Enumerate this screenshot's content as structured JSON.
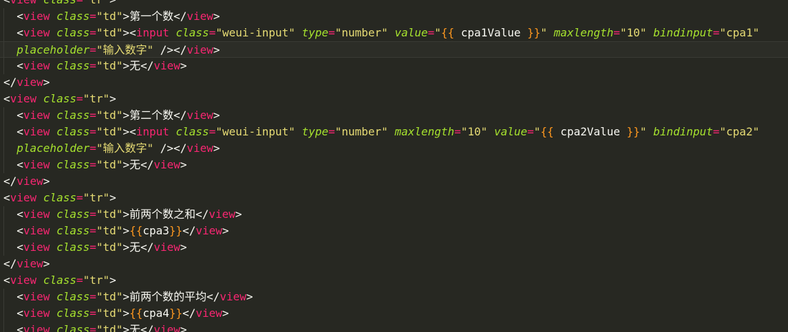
{
  "editor": {
    "language": "wxml",
    "current_line_index": 3,
    "colors": {
      "background": "#272822",
      "tag": "#f92672",
      "attribute": "#a6e22e",
      "string": "#e6db74",
      "brace": "#fd971f",
      "text": "#f8f8f2"
    },
    "lines": [
      [
        {
          "t": "lt",
          "v": "<"
        },
        {
          "t": "tag",
          "v": "view"
        },
        {
          "t": "txt",
          "v": " "
        },
        {
          "t": "attr",
          "v": "class"
        },
        {
          "t": "eq",
          "v": "="
        },
        {
          "t": "str",
          "v": "\"tr\""
        },
        {
          "t": "gt",
          "v": ">"
        }
      ],
      [
        {
          "t": "txt",
          "v": "  "
        },
        {
          "t": "lt",
          "v": "<"
        },
        {
          "t": "tag",
          "v": "view"
        },
        {
          "t": "txt",
          "v": " "
        },
        {
          "t": "attr",
          "v": "class"
        },
        {
          "t": "eq",
          "v": "="
        },
        {
          "t": "str",
          "v": "\"td\""
        },
        {
          "t": "gt",
          "v": ">"
        },
        {
          "t": "txt",
          "v": "第一个数"
        },
        {
          "t": "lt",
          "v": "</"
        },
        {
          "t": "tag",
          "v": "view"
        },
        {
          "t": "gt",
          "v": ">"
        }
      ],
      [
        {
          "t": "txt",
          "v": "  "
        },
        {
          "t": "lt",
          "v": "<"
        },
        {
          "t": "tag",
          "v": "view"
        },
        {
          "t": "txt",
          "v": " "
        },
        {
          "t": "attr",
          "v": "class"
        },
        {
          "t": "eq",
          "v": "="
        },
        {
          "t": "str",
          "v": "\"td\""
        },
        {
          "t": "gt",
          "v": ">"
        },
        {
          "t": "lt",
          "v": "<"
        },
        {
          "t": "tag",
          "v": "input"
        },
        {
          "t": "txt",
          "v": " "
        },
        {
          "t": "attr",
          "v": "class"
        },
        {
          "t": "eq",
          "v": "="
        },
        {
          "t": "str",
          "v": "\"weui-input\""
        },
        {
          "t": "txt",
          "v": " "
        },
        {
          "t": "attr",
          "v": "type"
        },
        {
          "t": "eq",
          "v": "="
        },
        {
          "t": "str",
          "v": "\"number\""
        },
        {
          "t": "txt",
          "v": " "
        },
        {
          "t": "attr",
          "v": "value"
        },
        {
          "t": "eq",
          "v": "="
        },
        {
          "t": "str",
          "v": "\""
        },
        {
          "t": "brace",
          "v": "{{"
        },
        {
          "t": "txt",
          "v": " cpa1Value "
        },
        {
          "t": "brace",
          "v": "}}"
        },
        {
          "t": "str",
          "v": "\""
        },
        {
          "t": "txt",
          "v": " "
        },
        {
          "t": "attr",
          "v": "maxlength"
        },
        {
          "t": "eq",
          "v": "="
        },
        {
          "t": "str",
          "v": "\"10\""
        },
        {
          "t": "txt",
          "v": " "
        },
        {
          "t": "attr",
          "v": "bindinput"
        },
        {
          "t": "eq",
          "v": "="
        },
        {
          "t": "str",
          "v": "\"cpa1\""
        }
      ],
      [
        {
          "t": "txt",
          "v": "  "
        },
        {
          "t": "attr",
          "v": "placeholder"
        },
        {
          "t": "eq",
          "v": "="
        },
        {
          "t": "str",
          "v": "\"输入数字\""
        },
        {
          "t": "txt",
          "v": " /"
        },
        {
          "t": "gt",
          "v": ">"
        },
        {
          "t": "lt",
          "v": "</"
        },
        {
          "t": "tag",
          "v": "view"
        },
        {
          "t": "gt",
          "v": ">"
        }
      ],
      [
        {
          "t": "txt",
          "v": "  "
        },
        {
          "t": "lt",
          "v": "<"
        },
        {
          "t": "tag",
          "v": "view"
        },
        {
          "t": "txt",
          "v": " "
        },
        {
          "t": "attr",
          "v": "class"
        },
        {
          "t": "eq",
          "v": "="
        },
        {
          "t": "str",
          "v": "\"td\""
        },
        {
          "t": "gt",
          "v": ">"
        },
        {
          "t": "txt",
          "v": "无"
        },
        {
          "t": "lt",
          "v": "</"
        },
        {
          "t": "tag",
          "v": "view"
        },
        {
          "t": "gt",
          "v": ">"
        }
      ],
      [
        {
          "t": "lt",
          "v": "</"
        },
        {
          "t": "tag",
          "v": "view"
        },
        {
          "t": "gt",
          "v": ">"
        }
      ],
      [
        {
          "t": "lt",
          "v": "<"
        },
        {
          "t": "tag",
          "v": "view"
        },
        {
          "t": "txt",
          "v": " "
        },
        {
          "t": "attr",
          "v": "class"
        },
        {
          "t": "eq",
          "v": "="
        },
        {
          "t": "str",
          "v": "\"tr\""
        },
        {
          "t": "gt",
          "v": ">"
        }
      ],
      [
        {
          "t": "txt",
          "v": "  "
        },
        {
          "t": "lt",
          "v": "<"
        },
        {
          "t": "tag",
          "v": "view"
        },
        {
          "t": "txt",
          "v": " "
        },
        {
          "t": "attr",
          "v": "class"
        },
        {
          "t": "eq",
          "v": "="
        },
        {
          "t": "str",
          "v": "\"td\""
        },
        {
          "t": "gt",
          "v": ">"
        },
        {
          "t": "txt",
          "v": "第二个数"
        },
        {
          "t": "lt",
          "v": "</"
        },
        {
          "t": "tag",
          "v": "view"
        },
        {
          "t": "gt",
          "v": ">"
        }
      ],
      [
        {
          "t": "txt",
          "v": "  "
        },
        {
          "t": "lt",
          "v": "<"
        },
        {
          "t": "tag",
          "v": "view"
        },
        {
          "t": "txt",
          "v": " "
        },
        {
          "t": "attr",
          "v": "class"
        },
        {
          "t": "eq",
          "v": "="
        },
        {
          "t": "str",
          "v": "\"td\""
        },
        {
          "t": "gt",
          "v": ">"
        },
        {
          "t": "lt",
          "v": "<"
        },
        {
          "t": "tag",
          "v": "input"
        },
        {
          "t": "txt",
          "v": " "
        },
        {
          "t": "attr",
          "v": "class"
        },
        {
          "t": "eq",
          "v": "="
        },
        {
          "t": "str",
          "v": "\"weui-input\""
        },
        {
          "t": "txt",
          "v": " "
        },
        {
          "t": "attr",
          "v": "type"
        },
        {
          "t": "eq",
          "v": "="
        },
        {
          "t": "str",
          "v": "\"number\""
        },
        {
          "t": "txt",
          "v": " "
        },
        {
          "t": "attr",
          "v": "maxlength"
        },
        {
          "t": "eq",
          "v": "="
        },
        {
          "t": "str",
          "v": "\"10\""
        },
        {
          "t": "txt",
          "v": " "
        },
        {
          "t": "attr",
          "v": "value"
        },
        {
          "t": "eq",
          "v": "="
        },
        {
          "t": "str",
          "v": "\""
        },
        {
          "t": "brace",
          "v": "{{"
        },
        {
          "t": "txt",
          "v": " cpa2Value "
        },
        {
          "t": "brace",
          "v": "}}"
        },
        {
          "t": "str",
          "v": "\""
        },
        {
          "t": "txt",
          "v": " "
        },
        {
          "t": "attr",
          "v": "bindinput"
        },
        {
          "t": "eq",
          "v": "="
        },
        {
          "t": "str",
          "v": "\"cpa2\""
        }
      ],
      [
        {
          "t": "txt",
          "v": "  "
        },
        {
          "t": "attr",
          "v": "placeholder"
        },
        {
          "t": "eq",
          "v": "="
        },
        {
          "t": "str",
          "v": "\"输入数字\""
        },
        {
          "t": "txt",
          "v": " /"
        },
        {
          "t": "gt",
          "v": ">"
        },
        {
          "t": "lt",
          "v": "</"
        },
        {
          "t": "tag",
          "v": "view"
        },
        {
          "t": "gt",
          "v": ">"
        }
      ],
      [
        {
          "t": "txt",
          "v": "  "
        },
        {
          "t": "lt",
          "v": "<"
        },
        {
          "t": "tag",
          "v": "view"
        },
        {
          "t": "txt",
          "v": " "
        },
        {
          "t": "attr",
          "v": "class"
        },
        {
          "t": "eq",
          "v": "="
        },
        {
          "t": "str",
          "v": "\"td\""
        },
        {
          "t": "gt",
          "v": ">"
        },
        {
          "t": "txt",
          "v": "无"
        },
        {
          "t": "lt",
          "v": "</"
        },
        {
          "t": "tag",
          "v": "view"
        },
        {
          "t": "gt",
          "v": ">"
        }
      ],
      [
        {
          "t": "lt",
          "v": "</"
        },
        {
          "t": "tag",
          "v": "view"
        },
        {
          "t": "gt",
          "v": ">"
        }
      ],
      [
        {
          "t": "lt",
          "v": "<"
        },
        {
          "t": "tag",
          "v": "view"
        },
        {
          "t": "txt",
          "v": " "
        },
        {
          "t": "attr",
          "v": "class"
        },
        {
          "t": "eq",
          "v": "="
        },
        {
          "t": "str",
          "v": "\"tr\""
        },
        {
          "t": "gt",
          "v": ">"
        }
      ],
      [
        {
          "t": "txt",
          "v": "  "
        },
        {
          "t": "lt",
          "v": "<"
        },
        {
          "t": "tag",
          "v": "view"
        },
        {
          "t": "txt",
          "v": " "
        },
        {
          "t": "attr",
          "v": "class"
        },
        {
          "t": "eq",
          "v": "="
        },
        {
          "t": "str",
          "v": "\"td\""
        },
        {
          "t": "gt",
          "v": ">"
        },
        {
          "t": "txt",
          "v": "前两个数之和"
        },
        {
          "t": "lt",
          "v": "</"
        },
        {
          "t": "tag",
          "v": "view"
        },
        {
          "t": "gt",
          "v": ">"
        }
      ],
      [
        {
          "t": "txt",
          "v": "  "
        },
        {
          "t": "lt",
          "v": "<"
        },
        {
          "t": "tag",
          "v": "view"
        },
        {
          "t": "txt",
          "v": " "
        },
        {
          "t": "attr",
          "v": "class"
        },
        {
          "t": "eq",
          "v": "="
        },
        {
          "t": "str",
          "v": "\"td\""
        },
        {
          "t": "gt",
          "v": ">"
        },
        {
          "t": "brace",
          "v": "{{"
        },
        {
          "t": "txt",
          "v": "cpa3"
        },
        {
          "t": "brace",
          "v": "}}"
        },
        {
          "t": "lt",
          "v": "</"
        },
        {
          "t": "tag",
          "v": "view"
        },
        {
          "t": "gt",
          "v": ">"
        }
      ],
      [
        {
          "t": "txt",
          "v": "  "
        },
        {
          "t": "lt",
          "v": "<"
        },
        {
          "t": "tag",
          "v": "view"
        },
        {
          "t": "txt",
          "v": " "
        },
        {
          "t": "attr",
          "v": "class"
        },
        {
          "t": "eq",
          "v": "="
        },
        {
          "t": "str",
          "v": "\"td\""
        },
        {
          "t": "gt",
          "v": ">"
        },
        {
          "t": "txt",
          "v": "无"
        },
        {
          "t": "lt",
          "v": "</"
        },
        {
          "t": "tag",
          "v": "view"
        },
        {
          "t": "gt",
          "v": ">"
        }
      ],
      [
        {
          "t": "lt",
          "v": "</"
        },
        {
          "t": "tag",
          "v": "view"
        },
        {
          "t": "gt",
          "v": ">"
        }
      ],
      [
        {
          "t": "lt",
          "v": "<"
        },
        {
          "t": "tag",
          "v": "view"
        },
        {
          "t": "txt",
          "v": " "
        },
        {
          "t": "attr",
          "v": "class"
        },
        {
          "t": "eq",
          "v": "="
        },
        {
          "t": "str",
          "v": "\"tr\""
        },
        {
          "t": "gt",
          "v": ">"
        }
      ],
      [
        {
          "t": "txt",
          "v": "  "
        },
        {
          "t": "lt",
          "v": "<"
        },
        {
          "t": "tag",
          "v": "view"
        },
        {
          "t": "txt",
          "v": " "
        },
        {
          "t": "attr",
          "v": "class"
        },
        {
          "t": "eq",
          "v": "="
        },
        {
          "t": "str",
          "v": "\"td\""
        },
        {
          "t": "gt",
          "v": ">"
        },
        {
          "t": "txt",
          "v": "前两个数的平均"
        },
        {
          "t": "lt",
          "v": "</"
        },
        {
          "t": "tag",
          "v": "view"
        },
        {
          "t": "gt",
          "v": ">"
        }
      ],
      [
        {
          "t": "txt",
          "v": "  "
        },
        {
          "t": "lt",
          "v": "<"
        },
        {
          "t": "tag",
          "v": "view"
        },
        {
          "t": "txt",
          "v": " "
        },
        {
          "t": "attr",
          "v": "class"
        },
        {
          "t": "eq",
          "v": "="
        },
        {
          "t": "str",
          "v": "\"td\""
        },
        {
          "t": "gt",
          "v": ">"
        },
        {
          "t": "brace",
          "v": "{{"
        },
        {
          "t": "txt",
          "v": "cpa4"
        },
        {
          "t": "brace",
          "v": "}}"
        },
        {
          "t": "lt",
          "v": "</"
        },
        {
          "t": "tag",
          "v": "view"
        },
        {
          "t": "gt",
          "v": ">"
        }
      ],
      [
        {
          "t": "txt",
          "v": "  "
        },
        {
          "t": "lt",
          "v": "<"
        },
        {
          "t": "tag",
          "v": "view"
        },
        {
          "t": "txt",
          "v": " "
        },
        {
          "t": "attr",
          "v": "class"
        },
        {
          "t": "eq",
          "v": "="
        },
        {
          "t": "str",
          "v": "\"td\""
        },
        {
          "t": "gt",
          "v": ">"
        },
        {
          "t": "txt",
          "v": "无"
        },
        {
          "t": "lt",
          "v": "</"
        },
        {
          "t": "tag",
          "v": "view"
        },
        {
          "t": "gt",
          "v": ">"
        }
      ]
    ]
  }
}
